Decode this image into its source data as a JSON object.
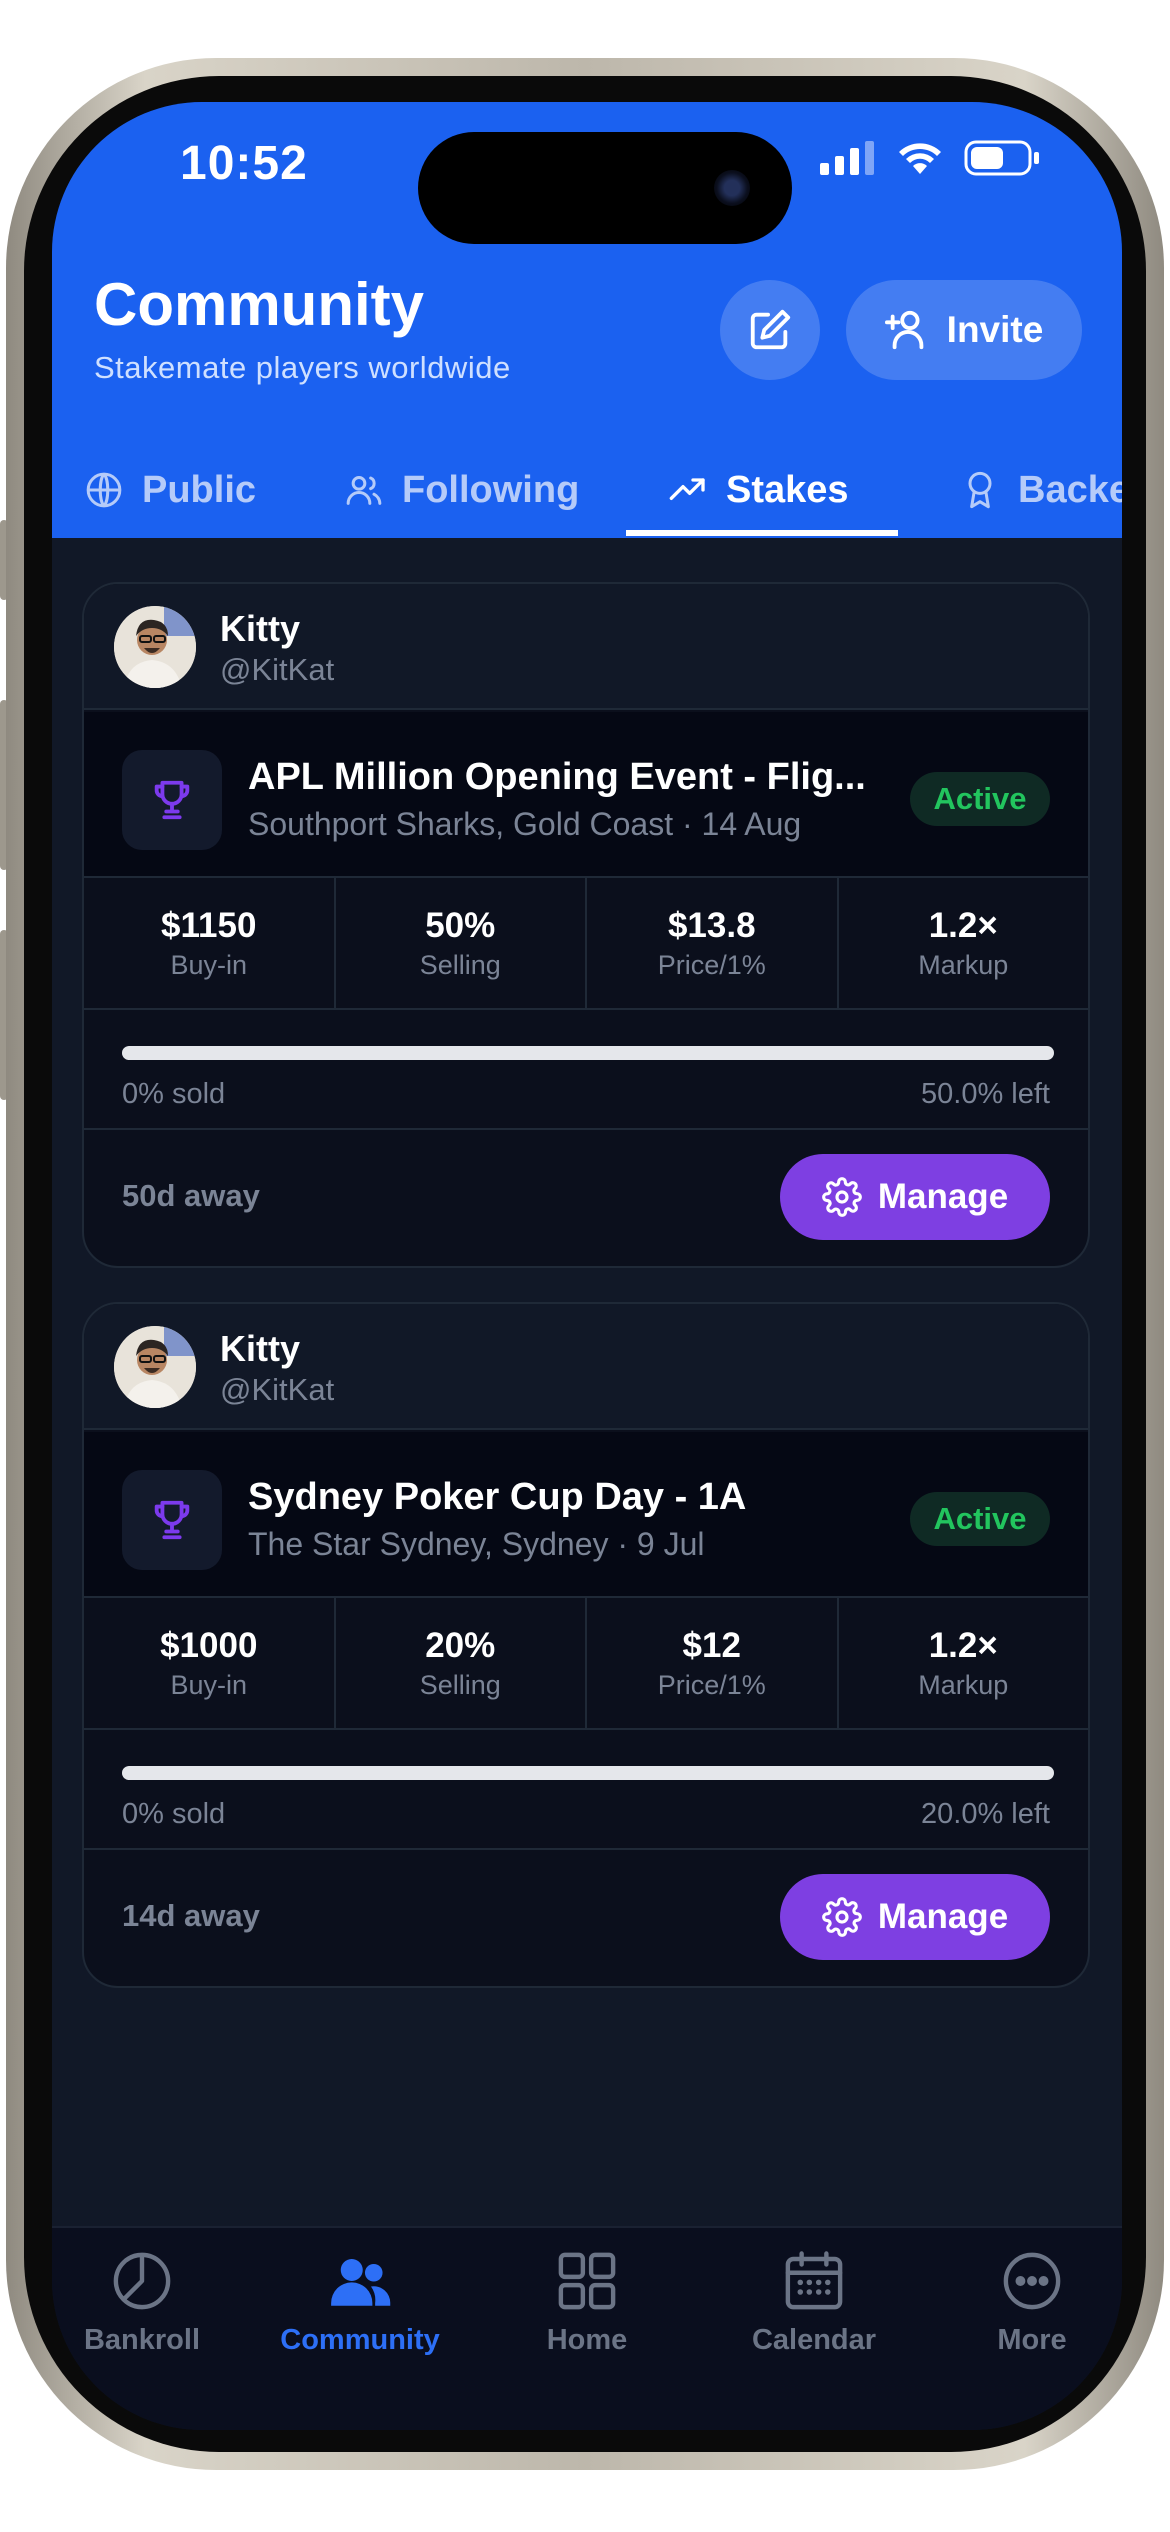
{
  "status_bar": {
    "time": "10:52"
  },
  "header": {
    "title": "Community",
    "subtitle": "Stakemate players worldwide",
    "invite_label": "Invite"
  },
  "tabs": [
    {
      "label": "Public",
      "icon": "globe-icon",
      "active": false
    },
    {
      "label": "Following",
      "icon": "users-icon",
      "active": false
    },
    {
      "label": "Stakes",
      "icon": "trending-up-icon",
      "active": true
    },
    {
      "label": "Backed",
      "icon": "award-icon",
      "active": false
    }
  ],
  "stakes": [
    {
      "user": {
        "name": "Kitty",
        "handle": "@KitKat"
      },
      "event": {
        "title": "APL Million Opening Event - Flig...",
        "subtitle": "Southport Sharks, Gold Coast · 14 Aug",
        "status": "Active"
      },
      "stats": [
        {
          "value": "$1150",
          "label": "Buy-in"
        },
        {
          "value": "50%",
          "label": "Selling"
        },
        {
          "value": "$13.8",
          "label": "Price/1%"
        },
        {
          "value": "1.2×",
          "label": "Markup"
        }
      ],
      "progress": {
        "sold_fraction": 0,
        "sold_text": "0% sold",
        "left_text": "50.0% left"
      },
      "time_away": "50d away",
      "manage_label": "Manage"
    },
    {
      "user": {
        "name": "Kitty",
        "handle": "@KitKat"
      },
      "event": {
        "title": "Sydney Poker Cup Day - 1A",
        "subtitle": "The Star Sydney, Sydney · 9 Jul",
        "status": "Active"
      },
      "stats": [
        {
          "value": "$1000",
          "label": "Buy-in"
        },
        {
          "value": "20%",
          "label": "Selling"
        },
        {
          "value": "$12",
          "label": "Price/1%"
        },
        {
          "value": "1.2×",
          "label": "Markup"
        }
      ],
      "progress": {
        "sold_fraction": 0,
        "sold_text": "0% sold",
        "left_text": "20.0% left"
      },
      "time_away": "14d away",
      "manage_label": "Manage"
    }
  ],
  "bottom_nav": [
    {
      "label": "Bankroll",
      "icon": "pie-chart-icon",
      "active": false
    },
    {
      "label": "Community",
      "icon": "people-icon",
      "active": true
    },
    {
      "label": "Home",
      "icon": "grid-icon",
      "active": false
    },
    {
      "label": "Calendar",
      "icon": "calendar-icon",
      "active": false
    },
    {
      "label": "More",
      "icon": "more-icon",
      "active": false
    }
  ],
  "colors": {
    "brand": "#1b61f0",
    "accent": "#7e3fe2",
    "active_badge": "#22c55e",
    "background": "#111827"
  }
}
